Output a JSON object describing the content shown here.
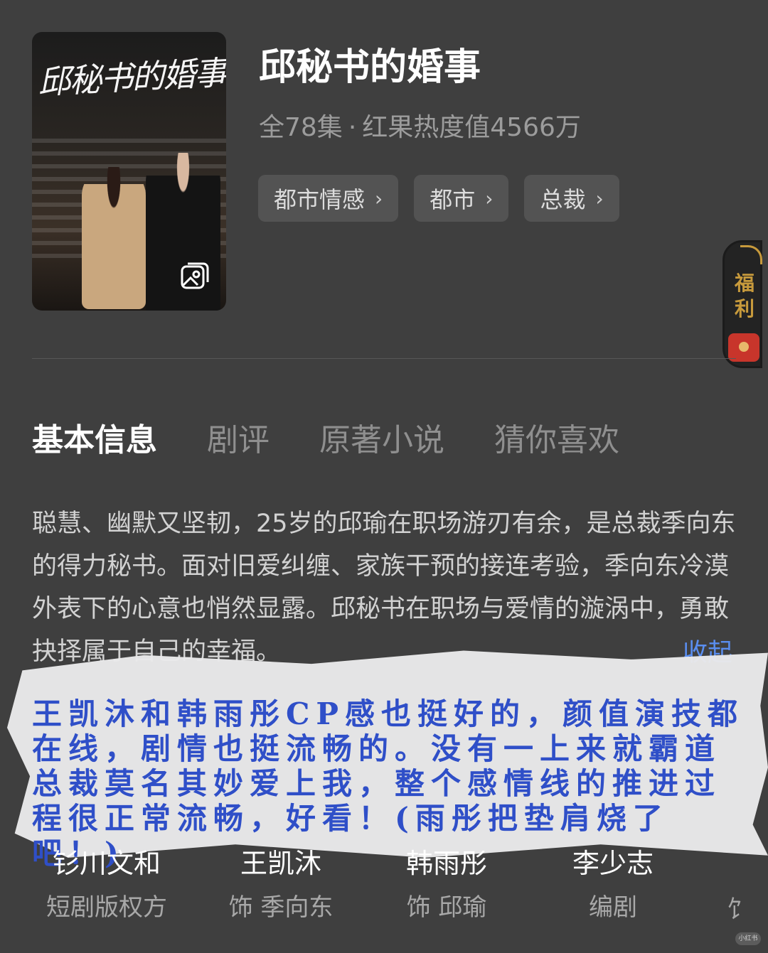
{
  "drama": {
    "title": "邱秘书的婚事",
    "episodes": "全78集",
    "heat": "红果热度值4566万",
    "poster_text": "邱秘书的婚事",
    "poster_icon": "gallery-icon"
  },
  "tags": [
    {
      "label": "都市情感",
      "icon": "chevron-right-icon"
    },
    {
      "label": "都市",
      "icon": "chevron-right-icon"
    },
    {
      "label": "总裁",
      "icon": "chevron-right-icon"
    }
  ],
  "welfare": {
    "label": "福利",
    "icon": "red-envelope-icon",
    "accent": "#c79a3c"
  },
  "tabs": [
    {
      "label": "基本信息",
      "active": true
    },
    {
      "label": "剧评",
      "active": false
    },
    {
      "label": "原著小说",
      "active": false
    },
    {
      "label": "猜你喜欢",
      "active": false
    }
  ],
  "description": "聪慧、幽默又坚韧，25岁的邱瑜在职场游刃有余，是总裁季向东的得力秘书。面对旧爱纠缠、家族干预的接连考验，季向东冷漠外表下的心意也悄然显露。邱秘书在职场与爱情的漩涡中，勇敢抉择属于自己的幸福。",
  "collapse_label": "收起",
  "note": "王凯沐和韩雨彤CP感也挺好的，颜值演技都在线，剧情也挺流畅的。没有一上来就霸道总裁莫名其妙爱上我，整个感情线的推进过程很正常流畅，好看！(雨彤把垫肩烧了吧！)",
  "cast": [
    {
      "name": "钐川文和",
      "role": "短剧版权方"
    },
    {
      "name": "王凯沐",
      "role": "饰 季向东"
    },
    {
      "name": "韩雨彤",
      "role": "饰 邱瑜"
    },
    {
      "name": "李少志",
      "role": "编剧"
    }
  ],
  "cast_partial": "饣",
  "watermark": "小红书",
  "colors": {
    "background": "#3f3f3f",
    "link": "#5a8ef0",
    "note_ink": "#2f4fc8",
    "tag_bg": "#535353"
  }
}
